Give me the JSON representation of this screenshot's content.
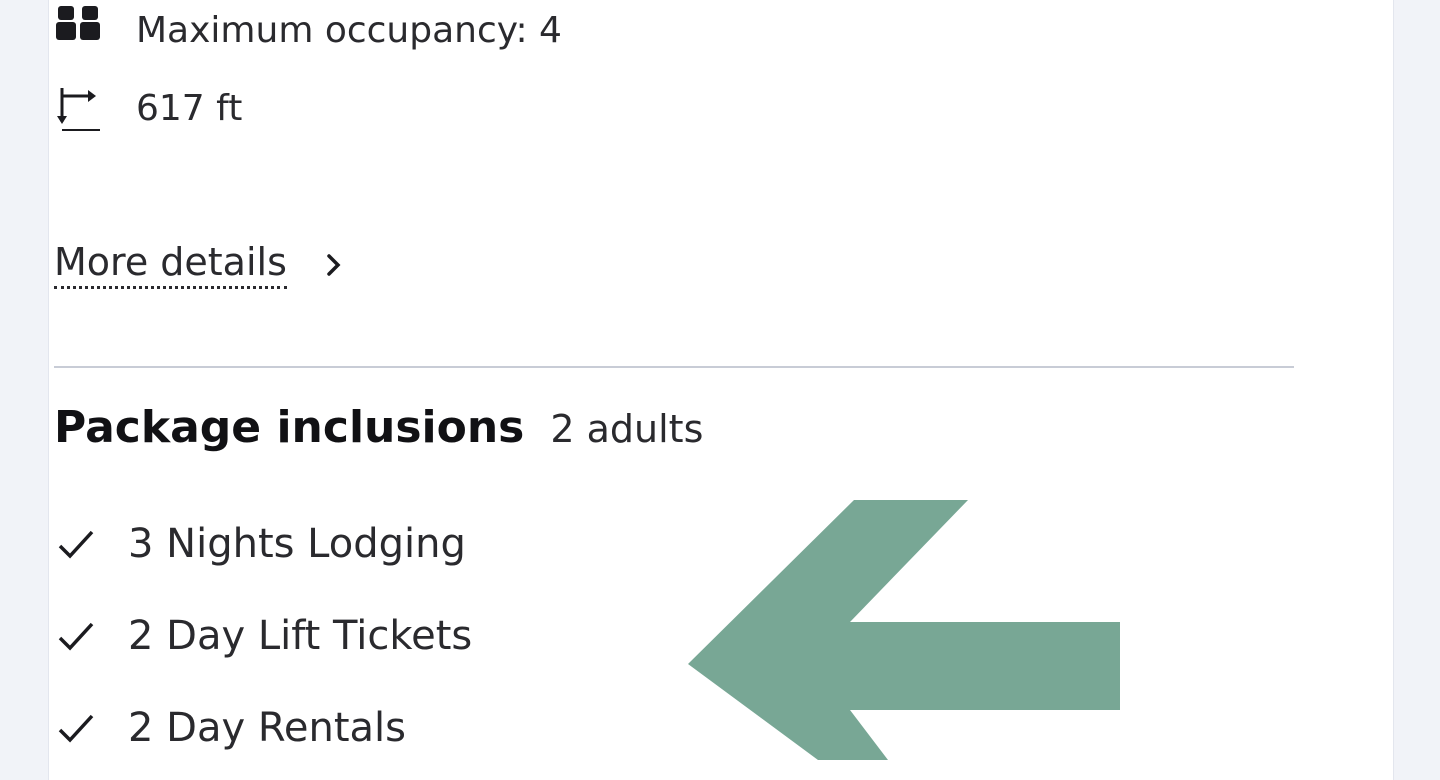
{
  "room_features": {
    "occupancy": {
      "icon": "people-icon",
      "text": "Maximum occupancy: 4"
    },
    "size": {
      "icon": "room-size-icon",
      "text": "617 ft"
    }
  },
  "more_details": {
    "label": "More details",
    "icon": "chevron-right-icon"
  },
  "package": {
    "title": "Package inclusions",
    "guests": "2 adults",
    "items": [
      {
        "icon": "check-icon",
        "label": "3 Nights Lodging"
      },
      {
        "icon": "check-icon",
        "label": "2 Day Lift Tickets"
      },
      {
        "icon": "check-icon",
        "label": "2 Day Rentals"
      }
    ]
  },
  "annotation": {
    "icon": "arrow-left-icon",
    "color": "#78a795"
  },
  "colors": {
    "page_background": "#f1f3f8",
    "card_background": "#ffffff",
    "text": "#2a2a2e",
    "divider": "#c8ccd6"
  }
}
